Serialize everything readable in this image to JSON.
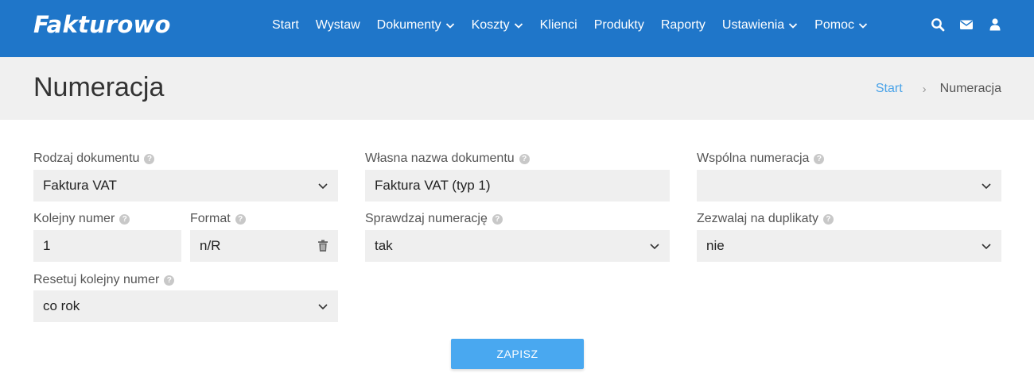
{
  "brand": {
    "logo": "Fakturowo",
    "primary_color": "#1f76c9",
    "accent_color": "#49a8f0"
  },
  "nav": {
    "items": [
      {
        "label": "Start",
        "dropdown": false
      },
      {
        "label": "Wystaw",
        "dropdown": false
      },
      {
        "label": "Dokumenty",
        "dropdown": true
      },
      {
        "label": "Koszty",
        "dropdown": true
      },
      {
        "label": "Klienci",
        "dropdown": false
      },
      {
        "label": "Produkty",
        "dropdown": false
      },
      {
        "label": "Raporty",
        "dropdown": false
      },
      {
        "label": "Ustawienia",
        "dropdown": true
      },
      {
        "label": "Pomoc",
        "dropdown": true
      }
    ],
    "icons": [
      "search-icon",
      "envelope-icon",
      "user-icon"
    ]
  },
  "header": {
    "title": "Numeracja",
    "breadcrumb": {
      "home": "Start",
      "separator": "›",
      "current": "Numeracja"
    }
  },
  "form": {
    "rodzaj_dokumentu": {
      "label": "Rodzaj dokumentu",
      "value": "Faktura VAT"
    },
    "wlasna_nazwa": {
      "label": "Własna nazwa dokumentu",
      "value": "Faktura VAT (typ 1)"
    },
    "wspolna_numeracja": {
      "label": "Wspólna numeracja",
      "value": ""
    },
    "kolejny_numer": {
      "label": "Kolejny numer",
      "value": "1"
    },
    "format": {
      "label": "Format",
      "value": "n/R"
    },
    "sprawdzaj_numeracje": {
      "label": "Sprawdzaj numerację",
      "value": "tak"
    },
    "zezwalaj_duplikaty": {
      "label": "Zezwalaj na duplikaty",
      "value": "nie"
    },
    "resetuj_numer": {
      "label": "Resetuj kolejny numer",
      "value": "co rok"
    },
    "help_glyph": "?",
    "save_label": "ZAPISZ"
  }
}
